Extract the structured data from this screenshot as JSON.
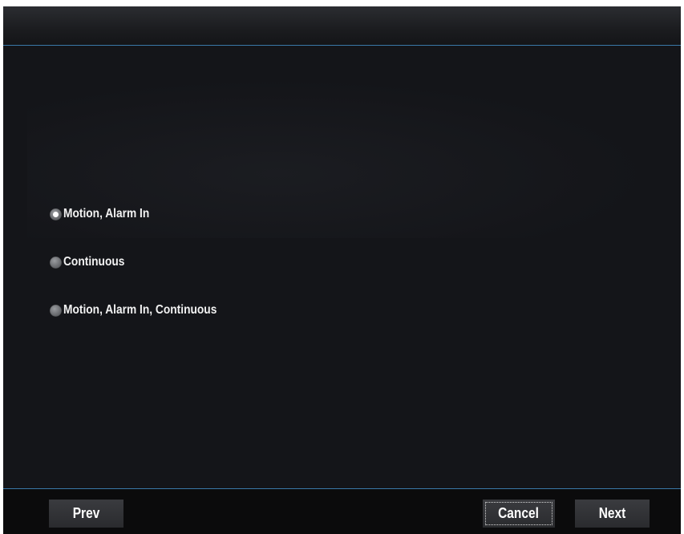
{
  "options": [
    {
      "label": "Motion, Alarm In",
      "checked": true
    },
    {
      "label": "Continuous",
      "checked": false
    },
    {
      "label": "Motion, Alarm In, Continuous",
      "checked": false
    }
  ],
  "buttons": {
    "prev": "Prev",
    "cancel": "Cancel",
    "next": "Next"
  },
  "colors": {
    "accent_line": "#3a78a8",
    "background": "#141519",
    "text": "#f2f2f2"
  }
}
